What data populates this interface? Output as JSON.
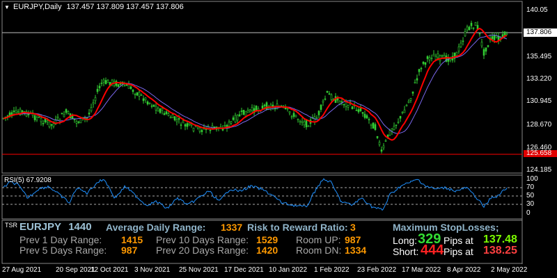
{
  "header": {
    "symbol_timeframe": "EURJPY,Daily",
    "ohlc": "137.457 137.809 137.457 137.806"
  },
  "price_axis": {
    "ticks": [
      "140.05",
      "137.806",
      "135.495",
      "133.220",
      "130.945",
      "128.670",
      "126.460",
      "125.658",
      "124.185"
    ],
    "current_price": "137.806",
    "red_line_price": "125.658"
  },
  "rsi": {
    "label": "RSI(5) 67.9208",
    "ticks": [
      "100",
      "70",
      "50",
      "30",
      "0"
    ]
  },
  "date_axis": [
    "27 Aug 2021",
    "20 Sep 2021",
    "12 Oct 2021",
    "3 Nov 2021",
    "25 Nov 2021",
    "17 Dec 2021",
    "10 Jan 2022",
    "1 Feb 2022",
    "23 Feb 2022",
    "17 Mar 2022",
    "8 Apr 2022",
    "2 May 2022"
  ],
  "tsr_panel": {
    "tag": "TSR",
    "symbol": "EURJPY",
    "period": "1440",
    "adr_label": "Average Daily Range:",
    "adr_value": "1337",
    "rrr_label": "Risk to Reward Ratio:",
    "rrr_value": "3",
    "max_sl_label": "Maximum StopLosses;",
    "prev1_label": "Prev 1 Day Range:",
    "prev1_value": "1415",
    "prev5_label": "Prev 5 Days Range:",
    "prev5_value": "987",
    "prev10_label": "Prev 10 Days Range:",
    "prev10_value": "1529",
    "prev20_label": "Prev 20 Days Range:",
    "prev20_value": "1420",
    "room_up_label": "Room UP:",
    "room_up_value": "987",
    "room_dn_label": "Room DN:",
    "room_dn_value": "1334",
    "long_label": "Long:",
    "long_pips": "329",
    "long_pips_at": "Pips at",
    "long_price": "137.48",
    "short_label": "Short:",
    "short_pips": "444",
    "short_pips_at": "Pips at",
    "short_price": "138.25"
  },
  "colors": {
    "background": "#000000",
    "candle": "#32cd32",
    "ma_fast": "#ff0000",
    "ma_slow": "#7b68ee",
    "rsi_line": "#1e90ff",
    "current_price_line": "#c0c0c0",
    "support_line": "#ff0000"
  }
}
